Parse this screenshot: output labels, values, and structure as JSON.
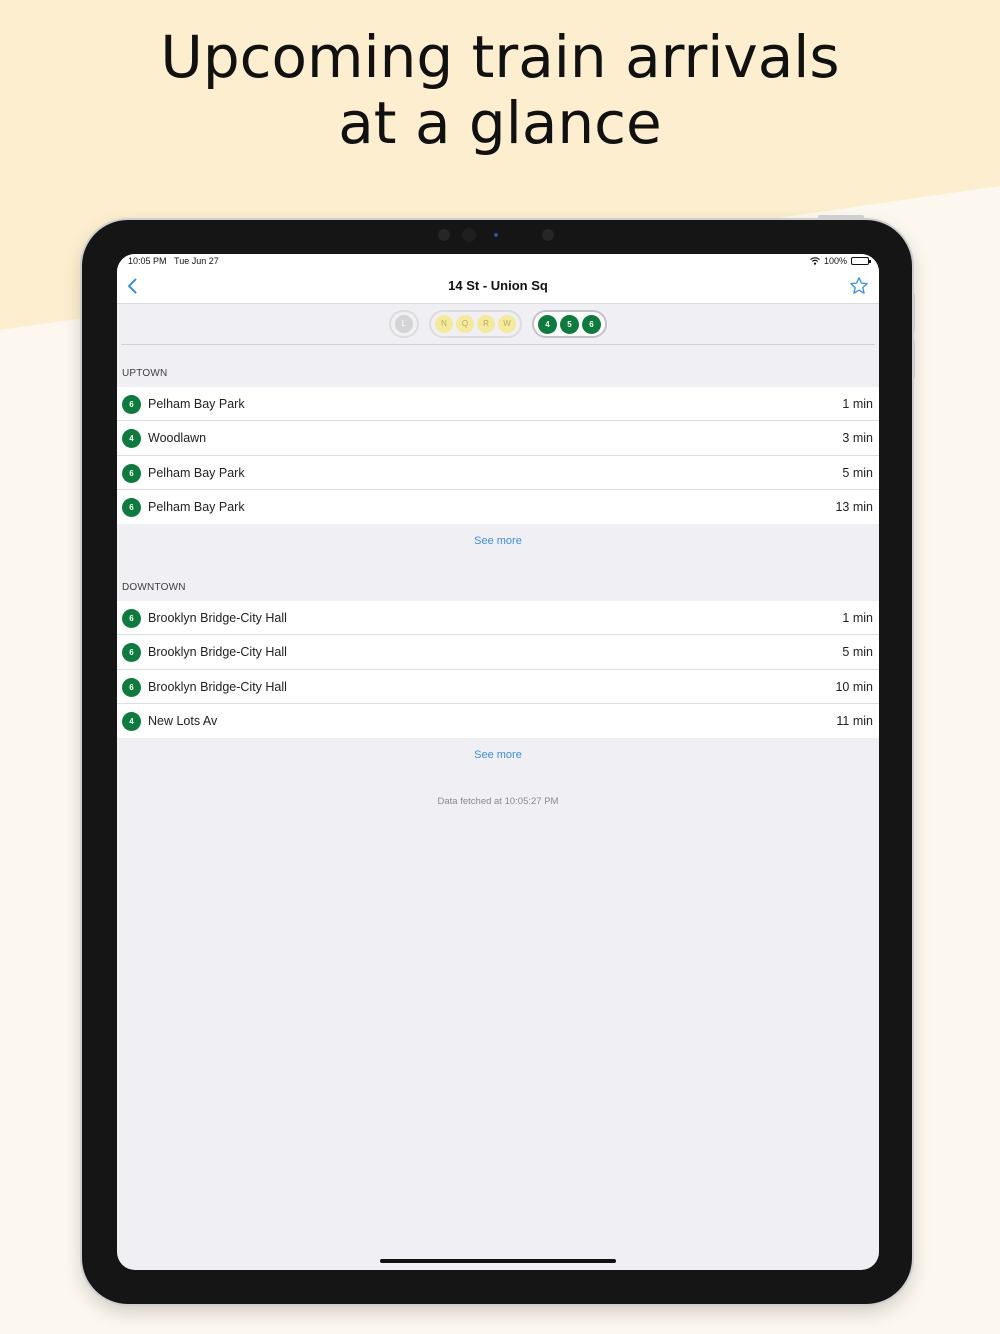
{
  "headline": {
    "line1": "Upcoming train arrivals",
    "line2": "at a glance"
  },
  "status_bar": {
    "time": "10:05 PM",
    "date": "Tue Jun 27",
    "battery": "100%"
  },
  "nav": {
    "title": "14 St - Union Sq",
    "back_icon": "chevron-left-icon",
    "favorite_icon": "star-outline-icon"
  },
  "line_groups": [
    {
      "lines": [
        "L"
      ],
      "style": "grey",
      "active": false
    },
    {
      "lines": [
        "N",
        "Q",
        "R",
        "W"
      ],
      "style": "yellow",
      "active": false
    },
    {
      "lines": [
        "4",
        "5",
        "6"
      ],
      "style": "green",
      "active": true
    }
  ],
  "uptown": {
    "header": "UPTOWN",
    "rows": [
      {
        "line": "6",
        "destination": "Pelham Bay Park",
        "time": "1 min"
      },
      {
        "line": "4",
        "destination": "Woodlawn",
        "time": "3 min"
      },
      {
        "line": "6",
        "destination": "Pelham Bay Park",
        "time": "5 min"
      },
      {
        "line": "6",
        "destination": "Pelham Bay Park",
        "time": "13 min"
      }
    ],
    "see_more": "See more"
  },
  "downtown": {
    "header": "DOWNTOWN",
    "rows": [
      {
        "line": "6",
        "destination": "Brooklyn Bridge-City Hall",
        "time": "1 min"
      },
      {
        "line": "6",
        "destination": "Brooklyn Bridge-City Hall",
        "time": "5 min"
      },
      {
        "line": "6",
        "destination": "Brooklyn Bridge-City Hall",
        "time": "10 min"
      },
      {
        "line": "4",
        "destination": "New Lots Av",
        "time": "11 min"
      }
    ],
    "see_more": "See more"
  },
  "footer": {
    "fetched": "Data fetched at 10:05:27 PM"
  },
  "colors": {
    "accent": "#3d8fe0",
    "line_456": "#0f7a3d",
    "line_nqrw": "#f4e99c",
    "line_l": "#d4d4d4",
    "headline_bg": "#fdeecf"
  }
}
